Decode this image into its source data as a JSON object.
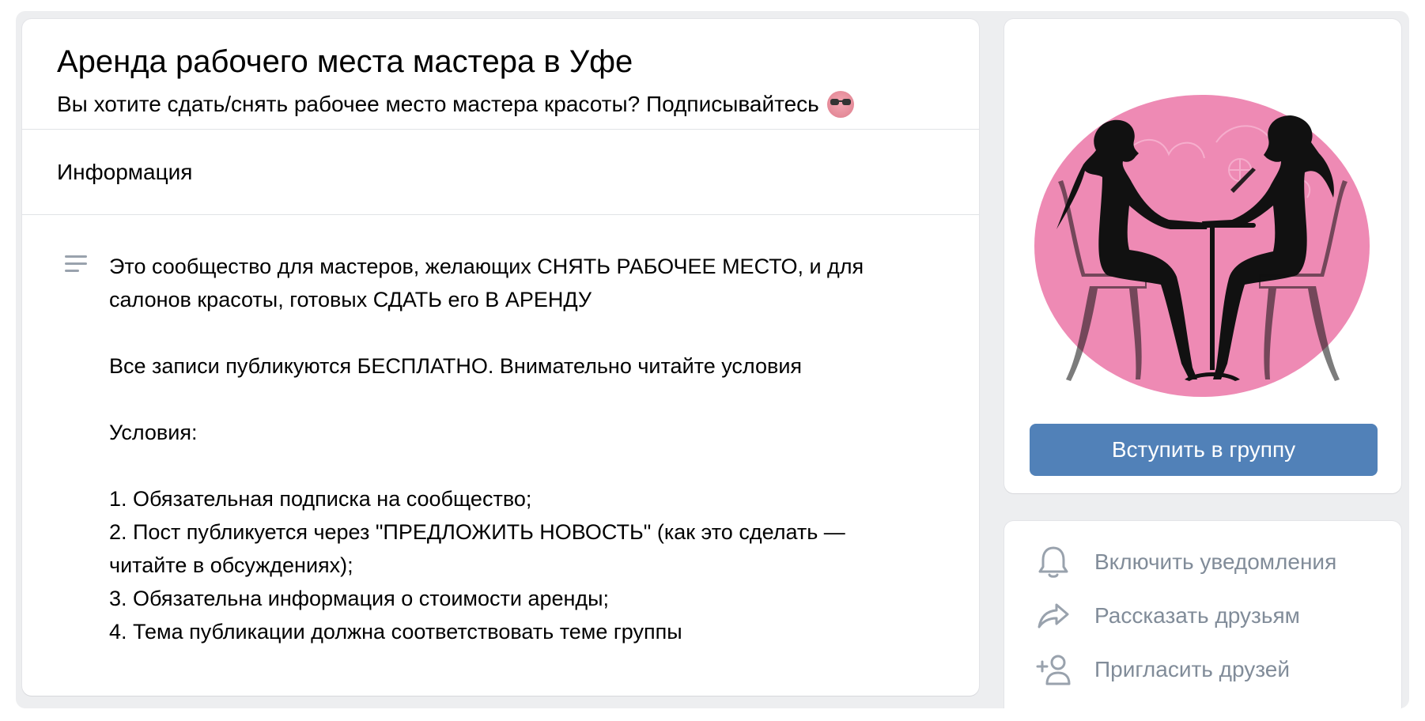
{
  "group": {
    "title": "Аренда рабочего места мастера в Уфе",
    "status": "Вы хотите сдать/снять рабочее место мастера красоты? Подписывайтесь",
    "status_emoji": "sunglasses-face-icon"
  },
  "section": {
    "label": "Информация"
  },
  "info": {
    "icon": "text-lines-icon",
    "lines": [
      "Это сообщество для мастеров, желающих СНЯТЬ РАБОЧЕЕ МЕСТО, и для",
      "салонов красоты, готовых СДАТЬ его В АРЕНДУ",
      "Все записи публикуются БЕСПЛАТНО. Внимательно читайте условия",
      "Условия:",
      "1. Обязательная подписка на сообщество;",
      "2. Пост публикуется через \"ПРЕДЛОЖИТЬ НОВОСТЬ\" (как это сделать —",
      "читайте в обсуждениях);",
      "3. Обязательна информация о стоимости аренды;",
      "4. Тема публикации должна соответствовать теме группы"
    ]
  },
  "sidebar": {
    "cover_image": "manicure-silhouettes-pink-circle",
    "join_label": "Вступить в группу",
    "actions": [
      {
        "label": "Включить уведомления",
        "icon": "bell-icon"
      },
      {
        "label": "Рассказать друзьям",
        "icon": "share-arrow-icon"
      },
      {
        "label": "Пригласить друзей",
        "icon": "add-user-icon"
      }
    ]
  },
  "colors": {
    "accent": "#5181b8",
    "background": "#edeef0",
    "muted_text": "#818c99",
    "cover_pink": "#ee8ab4"
  }
}
